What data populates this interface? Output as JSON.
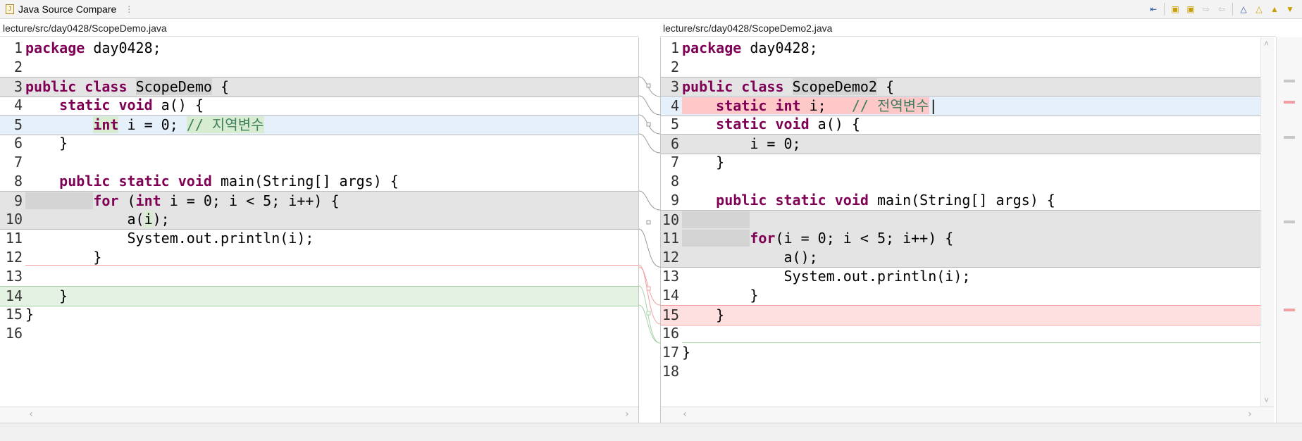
{
  "window": {
    "title": "Java Source Compare",
    "menu_icon": "vertical-ellipsis-icon"
  },
  "toolbar": {
    "buttons": [
      {
        "name": "copy-all-left-icon"
      },
      {
        "name": "copy-all-right-icon"
      },
      {
        "name": "copy-left-icon"
      },
      {
        "name": "copy-right-icon"
      },
      {
        "name": "next-diff-icon"
      },
      {
        "name": "prev-diff-icon"
      },
      {
        "name": "ignore-whitespace-icon"
      },
      {
        "name": "show-ancestor-icon"
      },
      {
        "name": "next-change-icon"
      },
      {
        "name": "prev-change-icon"
      }
    ]
  },
  "left": {
    "path": "lecture/src/day0428/ScopeDemo.java",
    "lines": [
      "1",
      "2",
      "3",
      "4",
      "5",
      "6",
      "7",
      "8",
      "9",
      "10",
      "11",
      "12",
      "13",
      "14",
      "15",
      "16"
    ]
  },
  "right": {
    "path": "lecture/src/day0428/ScopeDemo2.java",
    "lines": [
      "1",
      "2",
      "3",
      "4",
      "5",
      "6",
      "7",
      "8",
      "9",
      "10",
      "11",
      "12",
      "13",
      "14",
      "15",
      "16",
      "17",
      "18"
    ]
  },
  "colors": {
    "keyword": "#7f0055",
    "comment": "#3f7f5f",
    "change_gray": "#e4e4e4",
    "change_blue": "#e6f0fb",
    "removed_red": "#ffe0e0",
    "added_green": "#e4f2e4"
  }
}
